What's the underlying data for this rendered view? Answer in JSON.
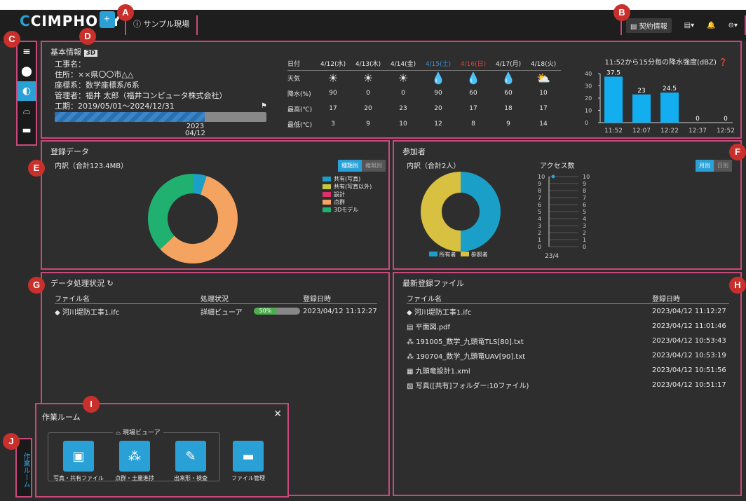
{
  "app": {
    "logo_main": "CIMPHONY",
    "logo_plus": "Plus",
    "site": "サンプル現場",
    "contract": "契約情報"
  },
  "badges": [
    "A",
    "B",
    "C",
    "D",
    "E",
    "F",
    "G",
    "H",
    "I",
    "J"
  ],
  "info": {
    "title": "基本情報",
    "tag": "3D",
    "lines": [
      "工事名：",
      "住所：××県〇〇市△△",
      "座標系：数学座標系/6系",
      "管理者：福井 太郎（福井コンピュータ株式会社）",
      "工期：2019/05/01～2024/12/31"
    ],
    "progress_year": "2023",
    "progress_date": "04/12",
    "progress_fraction": 0.71
  },
  "weather": {
    "header": "日付",
    "dates": [
      "4/12(水)",
      "4/13(木)",
      "4/14(金)",
      "4/15(土)",
      "4/16(日)",
      "4/17(月)",
      "4/18(火)"
    ],
    "date_colors": [
      "#e8e8e8",
      "#e8e8e8",
      "#e8e8e8",
      "#3b8fd6",
      "#e04040",
      "#e8e8e8",
      "#e8e8e8"
    ],
    "row_labels": [
      "天気",
      "降水(%)",
      "最高(℃)",
      "最低(℃)"
    ],
    "icons": [
      "☀",
      "☀",
      "☀",
      "💧",
      "💧",
      "💧",
      "⛅"
    ],
    "rain": [
      "90",
      "0",
      "0",
      "90",
      "60",
      "60",
      "10"
    ],
    "high": [
      "17",
      "20",
      "23",
      "20",
      "17",
      "18",
      "17"
    ],
    "low": [
      "3",
      "9",
      "10",
      "12",
      "8",
      "9",
      "14"
    ]
  },
  "chart_data": {
    "type": "bar",
    "title": "11:52から15分毎の降水強度(dBZ)",
    "categories": [
      "11:52",
      "12:07",
      "12:22",
      "12:37",
      "12:52"
    ],
    "values": [
      37.5,
      23,
      24.5,
      0,
      0
    ],
    "ylim": [
      0,
      40
    ],
    "yticks": [
      "40",
      "30",
      "20",
      "10",
      "0"
    ]
  },
  "registered": {
    "title": "登録データ",
    "subtitle": "内訳（合計123.4MB）",
    "toggle": [
      "種類別",
      "権限別"
    ],
    "legend": [
      "共有(写真)",
      "共有(写真以外)",
      "設計",
      "点群",
      "3Dモデル"
    ],
    "colors": [
      "#1a9fc9",
      "#c8c840",
      "#e0306a",
      "#f4a460",
      "#20b070"
    ],
    "shares": [
      0.05,
      0.0,
      0.0,
      0.58,
      0.37
    ]
  },
  "participants": {
    "title": "参加者",
    "subtitle": "内訳（合計2人）",
    "access_title": "アクセス数",
    "toggle": [
      "月別",
      "日別"
    ],
    "legend": [
      "所有者",
      "参照者"
    ],
    "colors": [
      "#1a9fc9",
      "#d8c040"
    ],
    "shares": [
      0.5,
      0.5
    ],
    "yticks": [
      "10",
      "9",
      "8",
      "7",
      "6",
      "5",
      "4",
      "3",
      "2",
      "1",
      "0"
    ],
    "x_label": "23/4"
  },
  "processing": {
    "title": "データ処理状況",
    "headers": [
      "ファイル名",
      "処理状況",
      "登録日時"
    ],
    "rows": [
      {
        "name": "河川堤防工事1.ifc",
        "status": "詳細ビューア",
        "pct": "50%",
        "date": "2023/04/12 11:12:27"
      }
    ]
  },
  "latest": {
    "title": "最新登録ファイル",
    "headers": [
      "ファイル名",
      "登録日時"
    ],
    "rows": [
      {
        "icon": "◆",
        "name": "河川堤防工事1.ifc",
        "date": "2023/04/12 11:12:27"
      },
      {
        "icon": "▤",
        "name": "平面図.pdf",
        "date": "2023/04/12 11:01:46"
      },
      {
        "icon": "⁂",
        "name": "191005_数学_九頭竜TLS[80].txt",
        "date": "2023/04/12 10:53:43"
      },
      {
        "icon": "⁂",
        "name": "190704_数学_九頭竜UAV[90].txt",
        "date": "2023/04/12 10:53:19"
      },
      {
        "icon": "▦",
        "name": "九頭竜設計1.xml",
        "date": "2023/04/12 10:51:56"
      },
      {
        "icon": "▨",
        "name": "写真([共有]フォルダー:10ファイル)",
        "date": "2023/04/12 10:51:17"
      }
    ]
  },
  "workroom": {
    "title": "作業ルーム",
    "close": "✕",
    "group": "現場ビューア",
    "tiles": [
      "写真・共有ファイル",
      "点群・土量進捗",
      "出来形・検査",
      "ファイル管理"
    ],
    "side_label": "作業ルーム"
  }
}
